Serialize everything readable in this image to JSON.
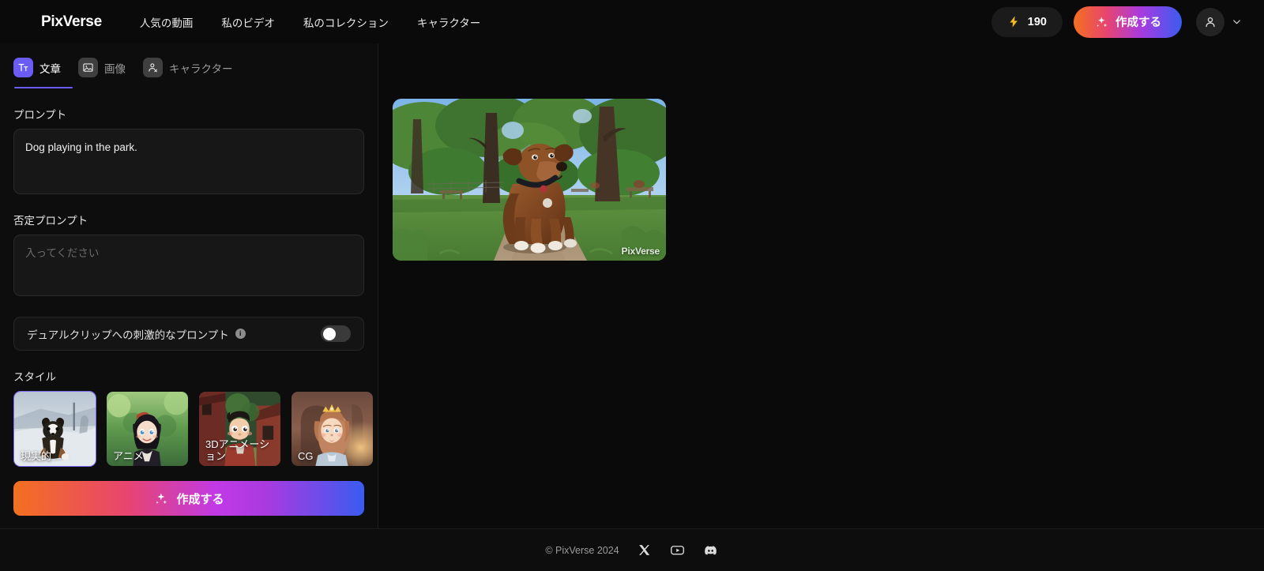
{
  "header": {
    "brand": "PixVerse",
    "nav": [
      {
        "label": "人気の動画",
        "name": "nav-popular-videos"
      },
      {
        "label": "私のビデオ",
        "name": "nav-my-videos"
      },
      {
        "label": "私のコレクション",
        "name": "nav-my-collection"
      },
      {
        "label": "キャラクター",
        "name": "nav-characters"
      }
    ],
    "credits": {
      "icon": "lightning-bolt-icon",
      "value": "190"
    },
    "create_button": {
      "label": "作成する",
      "icon": "sparkles-icon"
    },
    "account": {
      "avatar_icon": "user-avatar-icon",
      "chevron_icon": "chevron-down-icon"
    }
  },
  "sidebar": {
    "mode_tabs": [
      {
        "label": "文章",
        "icon": "text-icon",
        "active": true
      },
      {
        "label": "画像",
        "icon": "image-icon",
        "active": false
      },
      {
        "label": "キャラクター",
        "icon": "character-icon",
        "active": false
      }
    ],
    "prompt": {
      "label": "プロンプト",
      "value": "Dog playing in the park.",
      "placeholder": ""
    },
    "negative_prompt": {
      "label": "否定プロンプト",
      "value": "",
      "placeholder": "入ってください"
    },
    "dual_clip": {
      "label": "デュアルクリップへの刺激的なプロンプト",
      "info_glyph": "i",
      "enabled": false
    },
    "style": {
      "label": "スタイル",
      "options": [
        {
          "name": "現実的",
          "selected": true
        },
        {
          "name": "アニメ",
          "selected": false
        },
        {
          "name": "3Dアニメーション",
          "selected": false
        },
        {
          "name": "CG",
          "selected": false
        }
      ]
    },
    "create_button": {
      "label": "作成する",
      "icon": "sparkles-icon"
    }
  },
  "results": {
    "items": [
      {
        "watermark": "PixVerse",
        "alt": "Dog playing in the park"
      }
    ]
  },
  "footer": {
    "copyright": "© PixVerse 2024",
    "socials": [
      {
        "name": "x-twitter-icon"
      },
      {
        "name": "youtube-icon"
      },
      {
        "name": "discord-icon"
      }
    ]
  },
  "colors": {
    "accent_purple": "#6a5cf5",
    "gradient_start": "#f3701f",
    "gradient_end": "#3a5cf0",
    "credit_gold": "#f5b928",
    "background": "#0a0a0a"
  }
}
